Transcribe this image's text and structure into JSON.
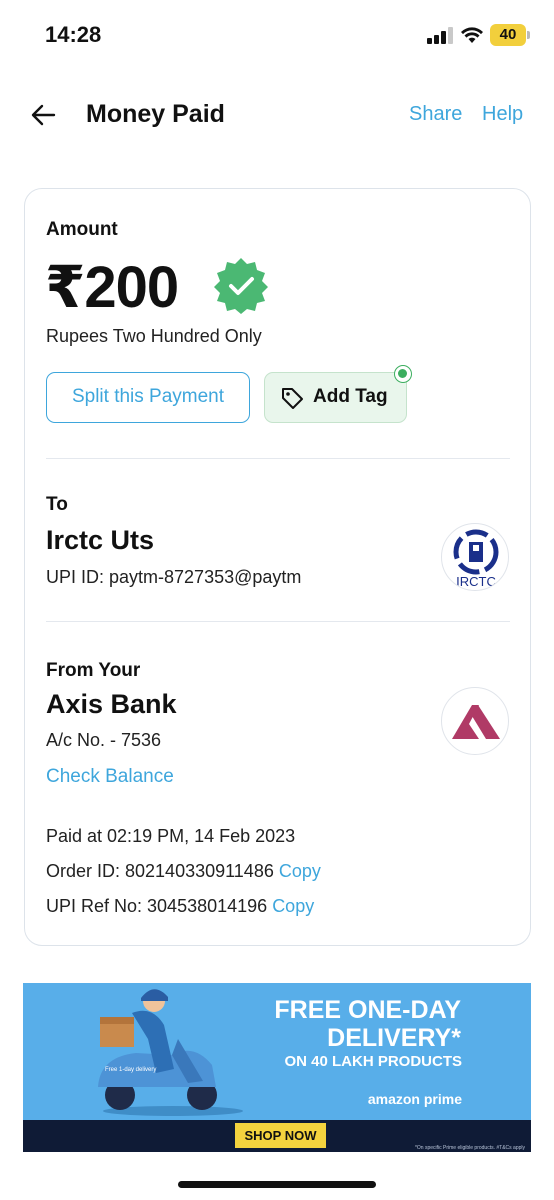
{
  "status_bar": {
    "time": "14:28",
    "battery": "40"
  },
  "header": {
    "title": "Money Paid",
    "share_label": "Share",
    "help_label": "Help"
  },
  "amount_section": {
    "label": "Amount",
    "amount": "₹200",
    "amount_words": "Rupees Two Hundred Only",
    "split_label": "Split this Payment",
    "tag_label": "Add Tag"
  },
  "to_section": {
    "label": "To",
    "name": "Irctc Uts",
    "upi_id": "UPI ID: paytm-8727353@paytm",
    "logo_text": "IRCTC"
  },
  "from_section": {
    "label": "From Your",
    "bank": "Axis Bank",
    "account": "A/c No. - 7536",
    "check_balance_label": "Check Balance"
  },
  "details": {
    "paid_at": "Paid at 02:19 PM, 14 Feb 2023",
    "order_id": "Order ID: 802140330911486",
    "upi_ref": "UPI Ref No: 304538014196",
    "copy_label": "Copy"
  },
  "ad": {
    "line1": "FREE ONE-DAY",
    "line2": "DELIVERY*",
    "line3": "ON 40 LAKH PRODUCTS",
    "brand": "amazon prime",
    "button": "SHOP NOW",
    "fine_print": "*On specific Prime eligible products. #T&Cs apply",
    "badge": "Free 1-day delivery"
  },
  "colors": {
    "accent": "#3ea6dc",
    "success": "#3cae5f",
    "ad_bg": "#58aee9",
    "axis": "#b03a66",
    "irctc": "#1a2f8a"
  }
}
